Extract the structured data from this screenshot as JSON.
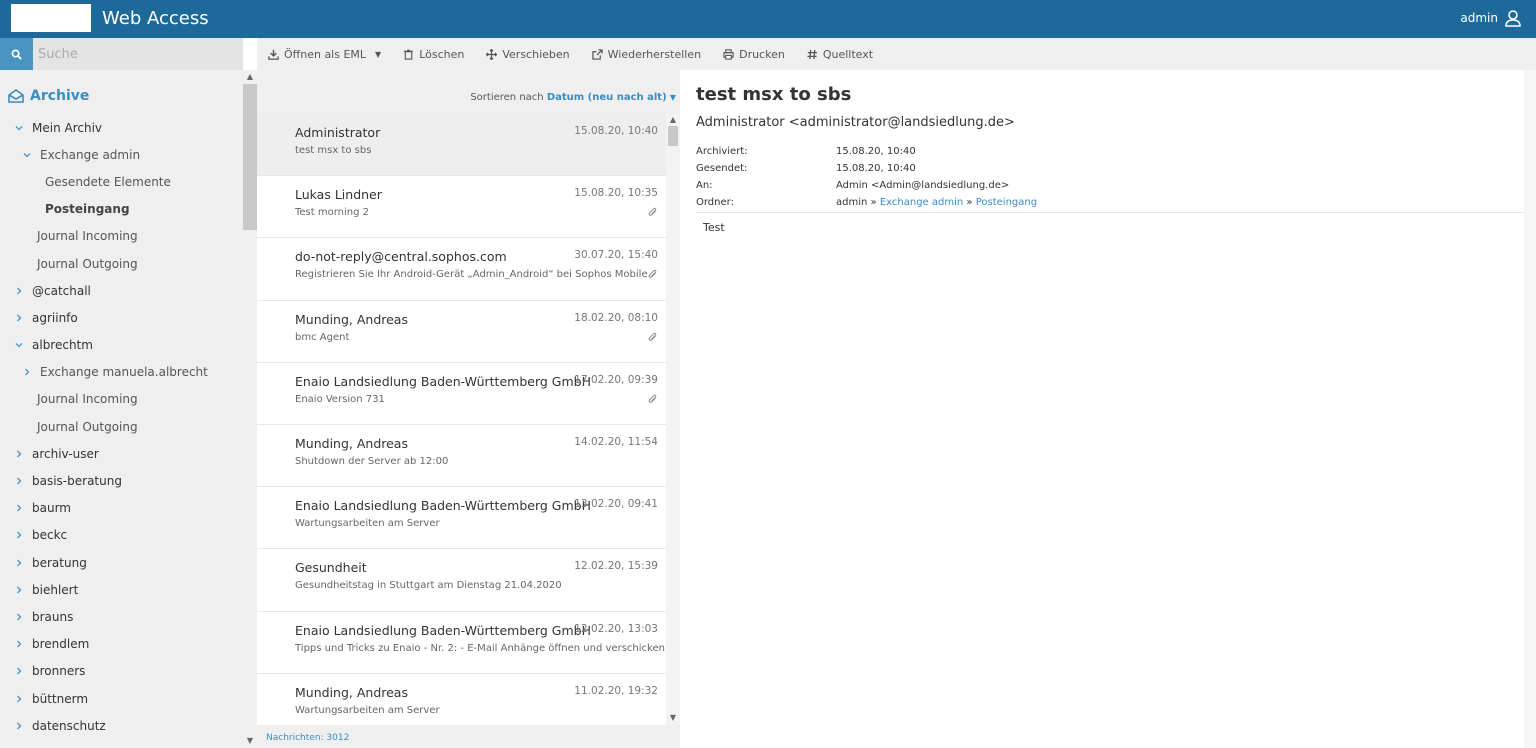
{
  "header": {
    "title": "Web Access",
    "user": "admin"
  },
  "search": {
    "placeholder": "Suche"
  },
  "toolbar": {
    "open_eml": "Öffnen als EML",
    "delete": "Löschen",
    "move": "Verschieben",
    "restore": "Wiederherstellen",
    "print": "Drucken",
    "source": "Quelltext"
  },
  "sidebar": {
    "archive_label": "Archive",
    "tree": [
      {
        "label": "Mein Archiv",
        "chevron": "down"
      },
      {
        "label": "Exchange admin",
        "chevron": "down"
      },
      {
        "label": "Gesendete Elemente"
      },
      {
        "label": "Posteingang",
        "selected": true
      },
      {
        "label": "Journal Incoming"
      },
      {
        "label": "Journal Outgoing"
      },
      {
        "label": "@catchall",
        "chevron": "right"
      },
      {
        "label": "agriinfo",
        "chevron": "right"
      },
      {
        "label": "albrechtm",
        "chevron": "down"
      },
      {
        "label": "Exchange manuela.albrecht",
        "chevron": "right"
      },
      {
        "label": "Journal Incoming"
      },
      {
        "label": "Journal Outgoing"
      },
      {
        "label": "archiv-user",
        "chevron": "right"
      },
      {
        "label": "basis-beratung",
        "chevron": "right"
      },
      {
        "label": "baurm",
        "chevron": "right"
      },
      {
        "label": "beckc",
        "chevron": "right"
      },
      {
        "label": "beratung",
        "chevron": "right"
      },
      {
        "label": "biehlert",
        "chevron": "right"
      },
      {
        "label": "brauns",
        "chevron": "right"
      },
      {
        "label": "brendlem",
        "chevron": "right"
      },
      {
        "label": "bronners",
        "chevron": "right"
      },
      {
        "label": "büttnerm",
        "chevron": "right"
      },
      {
        "label": "datenschutz",
        "chevron": "right"
      }
    ]
  },
  "messagelist": {
    "sort_prefix": "Sortieren nach",
    "sort_value": "Datum (neu nach alt)",
    "count_label": "Nachrichten: 3012",
    "messages": [
      {
        "from": "Administrator",
        "date": "15.08.20, 10:40",
        "subject": "test msx to sbs",
        "attachment": false,
        "selected": true
      },
      {
        "from": "Lukas Lindner",
        "date": "15.08.20, 10:35",
        "subject": "Test morning 2",
        "attachment": true
      },
      {
        "from": "do-not-reply@central.sophos.com",
        "date": "30.07.20, 15:40",
        "subject": "Registrieren Sie Ihr Android-Gerät „Admin_Android“ bei Sophos Mobile",
        "attachment": true
      },
      {
        "from": "Munding, Andreas",
        "date": "18.02.20, 08:10",
        "subject": "bmc Agent",
        "attachment": true
      },
      {
        "from": "Enaio Landsiedlung Baden-Württemberg GmbH",
        "date": "17.02.20, 09:39",
        "subject": "Enaio Version 731",
        "attachment": true
      },
      {
        "from": "Munding, Andreas",
        "date": "14.02.20, 11:54",
        "subject": "Shutdown der Server ab 12:00",
        "attachment": false
      },
      {
        "from": "Enaio Landsiedlung Baden-Württemberg GmbH",
        "date": "13.02.20, 09:41",
        "subject": "Wartungsarbeiten am Server",
        "attachment": false
      },
      {
        "from": "Gesundheit",
        "date": "12.02.20, 15:39",
        "subject": "Gesundheitstag in Stuttgart am Dienstag 21.04.2020",
        "attachment": false
      },
      {
        "from": "Enaio Landsiedlung Baden-Württemberg GmbH",
        "date": "12.02.20, 13:03",
        "subject": "Tipps und Tricks zu Enaio - Nr. 2: - E-Mail Anhänge öffnen und verschicken",
        "attachment": false
      },
      {
        "from": "Munding, Andreas",
        "date": "11.02.20, 19:32",
        "subject": "Wartungsarbeiten am Server",
        "attachment": false
      }
    ]
  },
  "reader": {
    "subject": "test msx to sbs",
    "from": "Administrator <administrator@landsiedlung.de>",
    "meta": {
      "archived_label": "Archiviert:",
      "archived": "15.08.20, 10:40",
      "sent_label": "Gesendet:",
      "sent": "15.08.20, 10:40",
      "to_label": "An:",
      "to": "Admin <Admin@landsiedlung.de>",
      "folder_label": "Ordner:",
      "folder_root": "admin",
      "folder_sep": "»",
      "folder_1": "Exchange admin",
      "folder_2": "Posteingang"
    },
    "body": "Test"
  },
  "colors": {
    "header_bg": "#1d6a9a",
    "accent": "#3a8cc4",
    "search_button": "#4a94c4"
  }
}
